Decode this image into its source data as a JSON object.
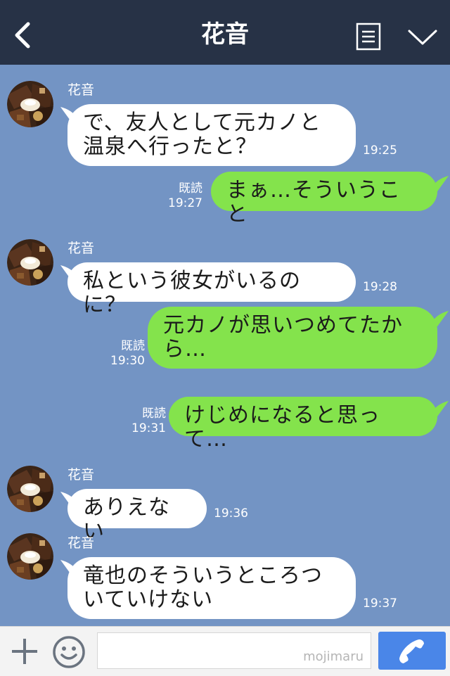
{
  "header": {
    "title": "花音"
  },
  "messages": [
    {
      "sender": "花音",
      "text": "で、友人として元カノと温泉へ行ったと？",
      "time": "19:25"
    },
    {
      "read": "既読",
      "text": "まぁ…そういうこと",
      "time": "19:27"
    },
    {
      "sender": "花音",
      "text": "私という彼女がいるのに？",
      "time": "19:28"
    },
    {
      "read": "既読",
      "text": "元カノが思いつめてたから…",
      "time": "19:30"
    },
    {
      "read": "既読",
      "text": "けじめになると思って…",
      "time": "19:31"
    },
    {
      "sender": "花音",
      "text": "ありえない",
      "time": "19:36"
    },
    {
      "sender": "花音",
      "text": "竜也のそういうところついていけない",
      "time": "19:37"
    }
  ],
  "footer": {
    "watermark": "mojimaru"
  },
  "colors": {
    "header": "#273246",
    "chat_background": "#7394c4",
    "incoming_bubble": "#ffffff",
    "outgoing_bubble": "#84e34c",
    "call_button": "#4a86e8"
  },
  "icons": [
    "back-icon",
    "menu-icon",
    "chevron-down-icon",
    "plus-icon",
    "emoji-icon",
    "phone-icon"
  ]
}
